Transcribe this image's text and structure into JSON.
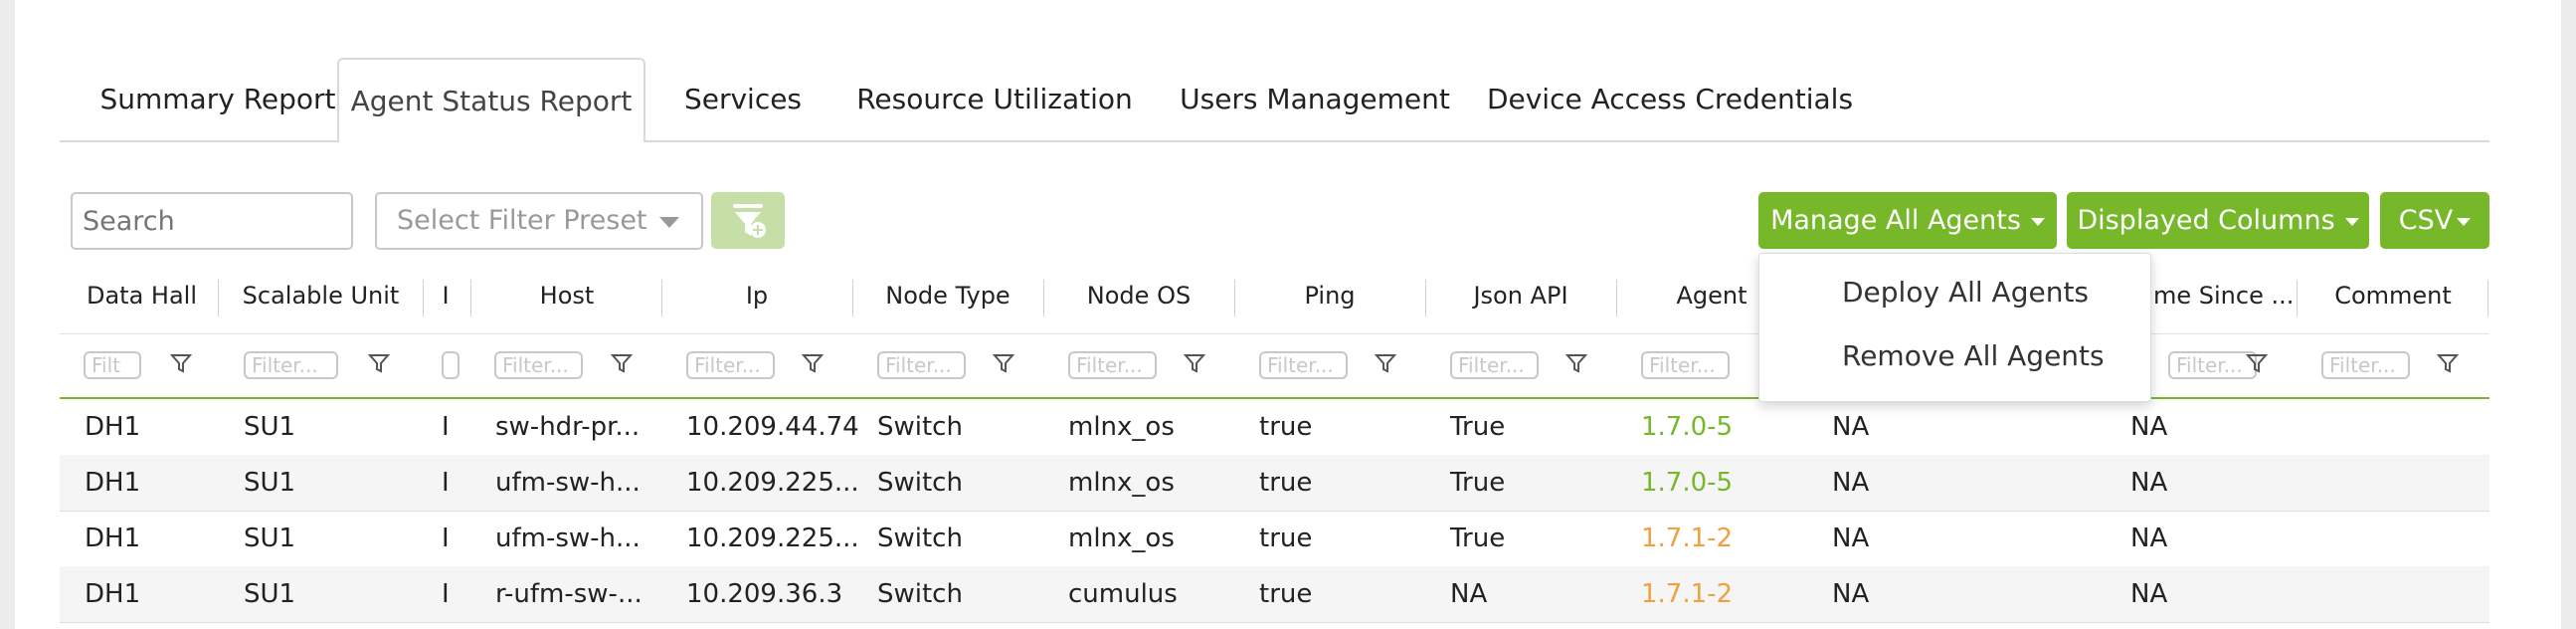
{
  "tabs": [
    {
      "label": "Summary Report",
      "active": false
    },
    {
      "label": "Agent Status Report",
      "active": true
    },
    {
      "label": "Services",
      "active": false
    },
    {
      "label": "Resource Utilization",
      "active": false
    },
    {
      "label": "Users Management",
      "active": false
    },
    {
      "label": "Device Access Credentials",
      "active": false
    }
  ],
  "toolbar": {
    "search_placeholder": "Search",
    "filter_preset_placeholder": "Select Filter Preset",
    "filter_button_icon": "filter-add-icon",
    "manage_agents_label": "Manage All Agents",
    "displayed_columns_label": "Displayed Columns",
    "csv_label": "CSV"
  },
  "manage_menu": {
    "items": [
      "Deploy All Agents",
      "Remove All Agents"
    ]
  },
  "table": {
    "columns": [
      "Data Hall",
      "Scalable Unit",
      "I",
      "Host",
      "Ip",
      "Node Type",
      "Node OS",
      "Ping",
      "Json API",
      "Agent",
      "me Since ...",
      "Comment"
    ],
    "filter_placeholder": "Filter...",
    "filter_placeholder_short": "Filt",
    "rows": [
      [
        "DH1",
        "SU1",
        "I",
        "sw-hdr-pr...",
        "10.209.44.74",
        "Switch",
        "mlnx_os",
        "true",
        "True",
        "1.7.0-5",
        "NA",
        "NA"
      ],
      [
        "DH1",
        "SU1",
        "I",
        "ufm-sw-h...",
        "10.209.225...",
        "Switch",
        "mlnx_os",
        "true",
        "True",
        "1.7.0-5",
        "NA",
        "NA"
      ],
      [
        "DH1",
        "SU1",
        "I",
        "ufm-sw-h...",
        "10.209.225...",
        "Switch",
        "mlnx_os",
        "true",
        "True",
        "1.7.1-2",
        "NA",
        "NA"
      ],
      [
        "DH1",
        "SU1",
        "I",
        "r-ufm-sw-...",
        "10.209.36.3",
        "Switch",
        "cumulus",
        "true",
        "NA",
        "1.7.1-2",
        "NA",
        "NA"
      ]
    ],
    "agent_colors": [
      "#76b82a",
      "#76b82a",
      "#f0a040",
      "#f0a040"
    ]
  },
  "colors": {
    "accent": "#76b82a",
    "accent_light": "#c5dfa6",
    "warning": "#f0a040"
  }
}
